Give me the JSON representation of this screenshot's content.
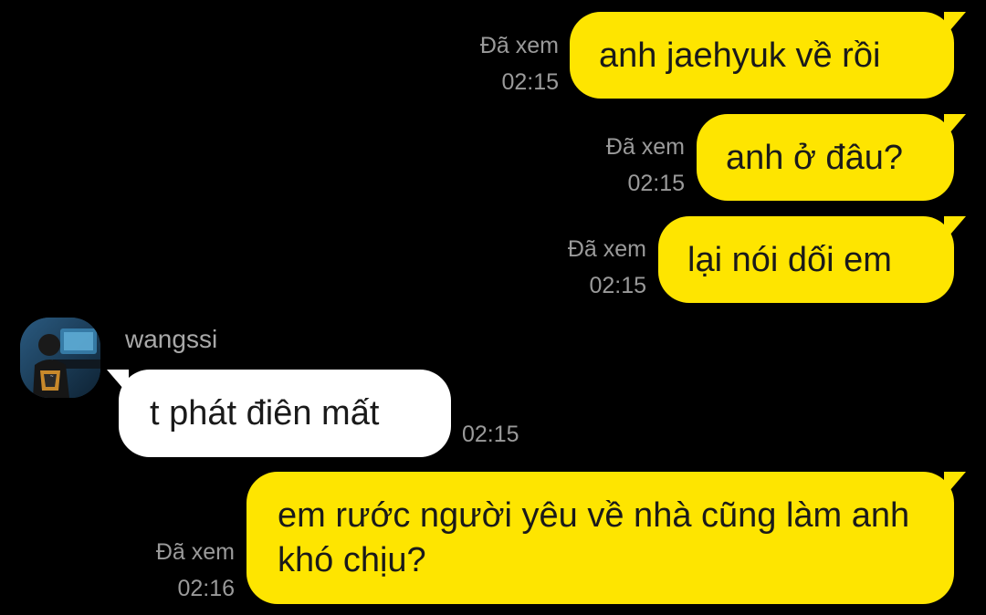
{
  "messages": [
    {
      "text": "anh jaehyuk về rồi",
      "read_label": "Đã xem",
      "time": "02:15"
    },
    {
      "text": "anh ở đâu?",
      "read_label": "Đã xem",
      "time": "02:15"
    },
    {
      "text": "lại nói dối em",
      "read_label": "Đã xem",
      "time": "02:15"
    },
    {
      "sender": "wangssi",
      "avatar_icon": "user-avatar-photo",
      "text": "t phát điên mất",
      "time": "02:15"
    },
    {
      "text": "em rước người yêu về nhà cũng làm anh khó chịu?",
      "read_label": "Đã xem",
      "time": "02:16"
    }
  ],
  "colors": {
    "background": "#000000",
    "outgoing_bubble": "#FEE500",
    "incoming_bubble": "#FFFFFF",
    "meta_text": "#9A9A9A"
  }
}
